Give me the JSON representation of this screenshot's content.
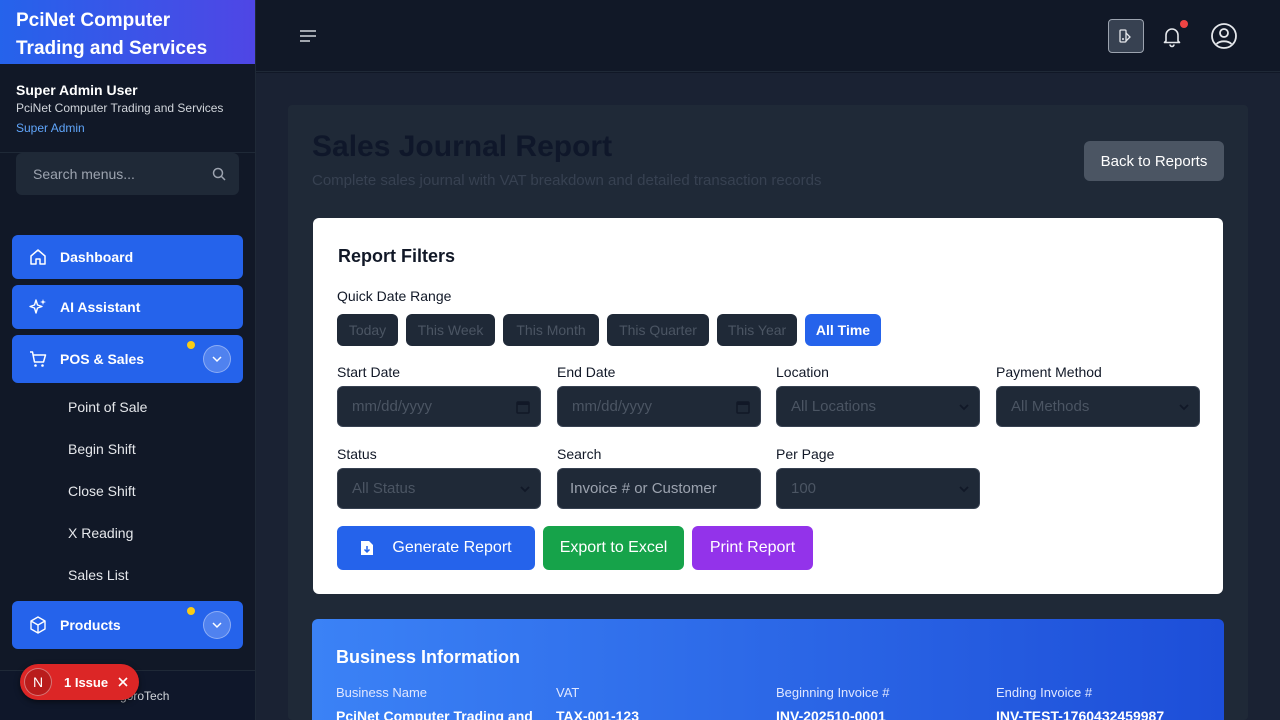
{
  "sidebar": {
    "brand": "PciNet Computer Trading and Services",
    "user_name": "Super Admin User",
    "user_org": "PciNet Computer Trading and Services",
    "user_role": "Super Admin",
    "search_placeholder": "Search menus...",
    "items": [
      {
        "label": "Dashboard",
        "icon": "home-icon"
      },
      {
        "label": "AI Assistant",
        "icon": "sparkles-icon"
      },
      {
        "label": "POS & Sales",
        "icon": "cart-icon",
        "expanded": true
      },
      {
        "label": "Products",
        "icon": "cube-icon",
        "expanded": true
      }
    ],
    "pos_subitems": [
      "Point of Sale",
      "Begin Shift",
      "Close Shift",
      "X Reading",
      "Sales List"
    ],
    "footer_text": "goroTech"
  },
  "issue_badge": {
    "initial": "N",
    "label": "1 Issue"
  },
  "header": {
    "title": "Sales Journal Report",
    "subtitle": "Complete sales journal with VAT breakdown and detailed transaction records",
    "back_button": "Back to Reports"
  },
  "filters": {
    "title": "Report Filters",
    "quick_range_label": "Quick Date Range",
    "quick_ranges": [
      "Today",
      "This Week",
      "This Month",
      "This Quarter",
      "This Year",
      "All Time"
    ],
    "active_range": "All Time",
    "start_date_label": "Start Date",
    "start_date_placeholder": "mm/dd/yyyy",
    "end_date_label": "End Date",
    "end_date_placeholder": "mm/dd/yyyy",
    "location_label": "Location",
    "location_value": "All Locations",
    "payment_label": "Payment Method",
    "payment_value": "All Methods",
    "status_label": "Status",
    "status_value": "All Status",
    "search_label": "Search",
    "search_placeholder": "Invoice # or Customer",
    "per_page_label": "Per Page",
    "per_page_value": "100",
    "generate_button": "Generate Report",
    "export_button": "Export to Excel",
    "print_button": "Print Report"
  },
  "business": {
    "title": "Business Information",
    "name_label": "Business Name",
    "name_value": "PciNet Computer Trading and",
    "vat_label": "VAT",
    "vat_value": "TAX-001-123",
    "begin_label": "Beginning Invoice #",
    "begin_value": "INV-202510-0001",
    "end_label": "Ending Invoice #",
    "end_value": "INV-TEST-1760432459987"
  },
  "colors": {
    "accent": "#2563eb",
    "success": "#16a34a",
    "purple": "#9333ea",
    "danger": "#dc2626"
  }
}
